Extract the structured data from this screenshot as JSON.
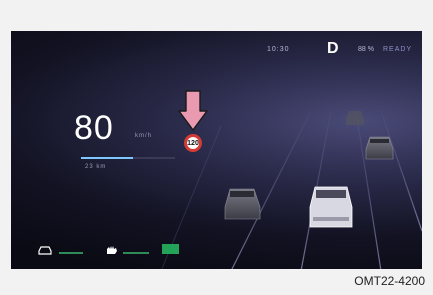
{
  "status": {
    "time": "10:30",
    "gear": "D",
    "battery": "88 %",
    "ready": "READY"
  },
  "speed": {
    "value": "80",
    "unit": "km/h",
    "sub": "23 km",
    "bar_fraction": 0.55
  },
  "speed_limit": {
    "value": "120"
  },
  "bottom": {
    "label1": "",
    "label2": "",
    "badge": ""
  },
  "caption": "OMT22-4200",
  "colors": {
    "accent": "#7fc7ff",
    "limit_ring": "#d43b35",
    "indicator": "#e99ab1",
    "status_green": "#23a357"
  },
  "icons": {
    "arrow": "down-arrow-icon",
    "bottom_left": "car-icon",
    "bottom_mid": "hand-icon"
  }
}
